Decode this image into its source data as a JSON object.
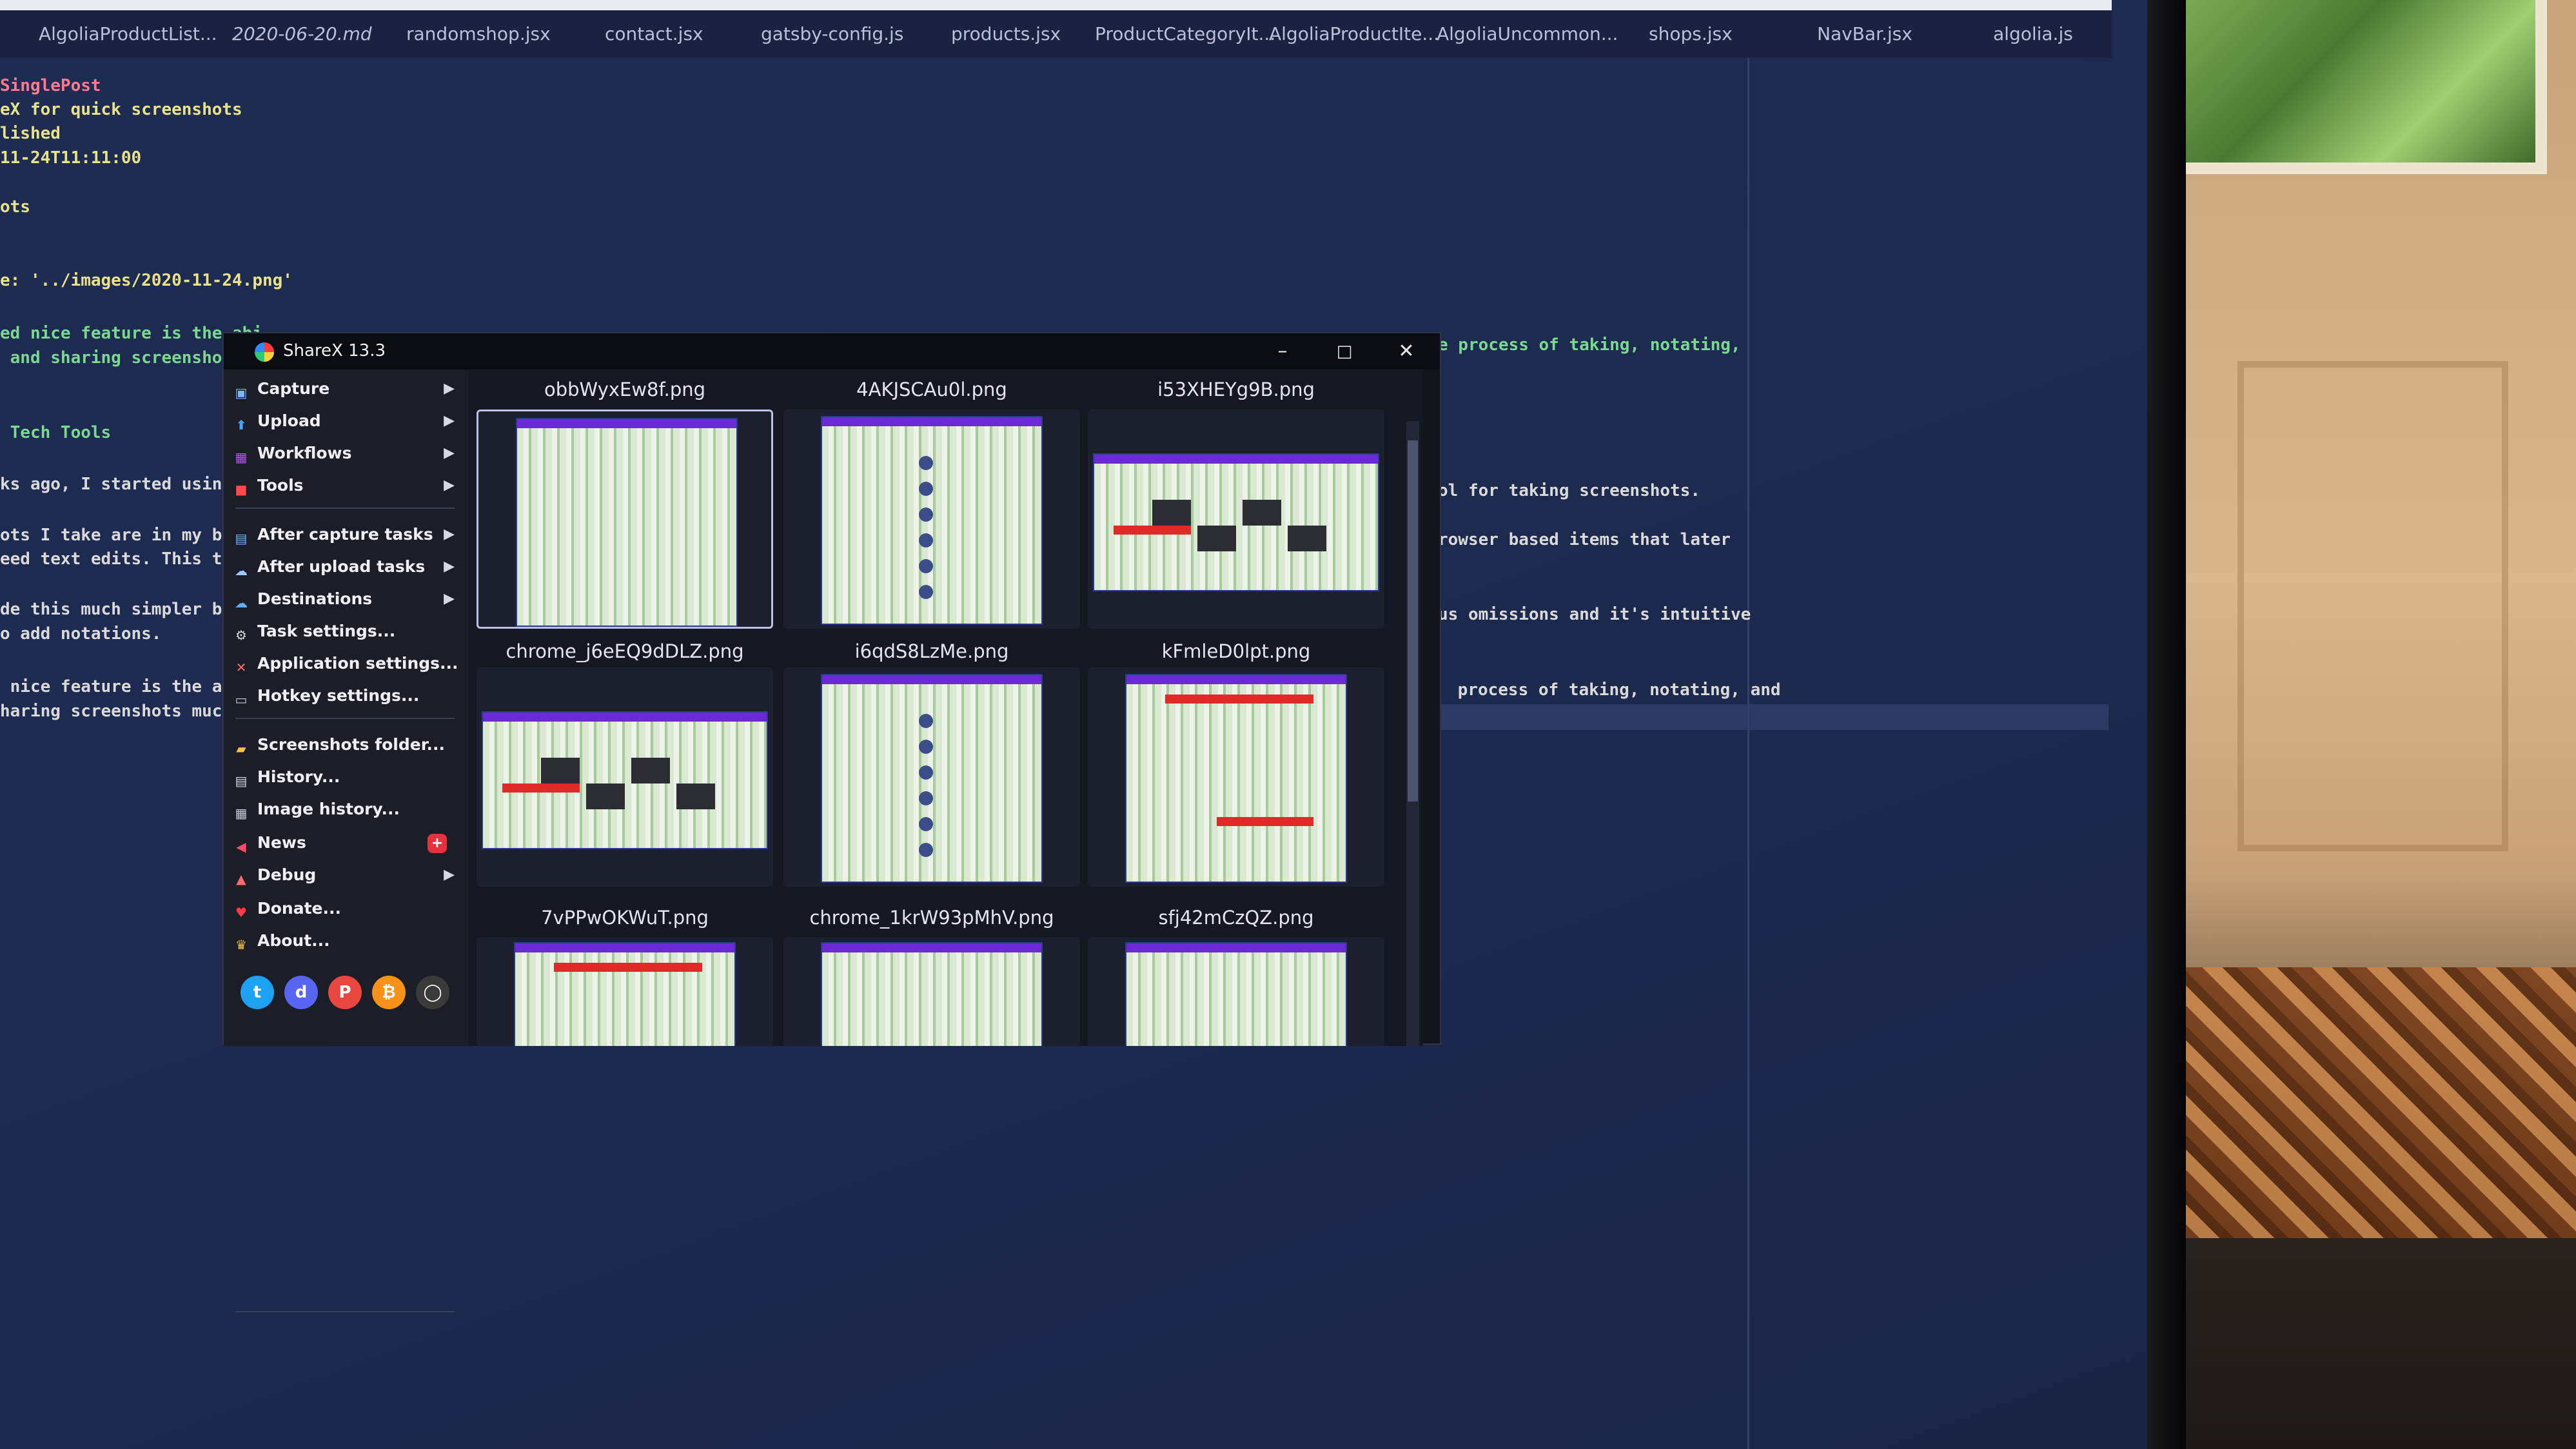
{
  "editor": {
    "tabs": [
      "AlgoliaProductList...",
      "2020-06-20.md",
      "randomshop.jsx",
      "contact.jsx",
      "gatsby-config.js",
      "products.jsx",
      "ProductCategoryIt...",
      "AlgoliaProductIte...",
      "AlgoliaUncommon...",
      "shops.jsx",
      "NavBar.jsx",
      "algolia.js"
    ],
    "code_lines": [
      {
        "text": "SinglePost",
        "color": "red"
      },
      {
        "text": "eX for quick screenshots",
        "color": "str"
      },
      {
        "text": "lished",
        "color": "str"
      },
      {
        "text": "11-24T11:11:00",
        "color": "str"
      },
      {
        "text": "ots",
        "color": "str"
      },
      {
        "text": "e: '../images/2020-11-24.png'",
        "color": "str"
      },
      {
        "text": "ed nice feature is the abi",
        "color": "key"
      },
      {
        "text": " and sharing screenshots m",
        "color": "key"
      },
      {
        "text": " Tech Tools",
        "color": "key"
      },
      {
        "text": "ks ago, I started using S",
        "color": "white"
      },
      {
        "text": "ots I take are in my brow",
        "color": "white"
      },
      {
        "text": "eed text edits. This typi",
        "color": "white"
      },
      {
        "text": "de this much simpler by m",
        "color": "white"
      },
      {
        "text": "o add notations.",
        "color": "white"
      },
      {
        "text": " nice feature is the abil",
        "color": "white"
      },
      {
        "text": "haring screenshots much f",
        "color": "white"
      }
    ],
    "right_lines": [
      {
        "text": "e process of taking, notating,",
        "color": "key"
      },
      {
        "text": "ol for taking screenshots.",
        "color": "white"
      },
      {
        "text": "rowser based items that later",
        "color": "white"
      },
      {
        "text": "us omissions and it's intuitive",
        "color": "white"
      },
      {
        "text": " process of taking, notating, and",
        "color": "white"
      }
    ]
  },
  "sharex": {
    "title": "ShareX 13.3",
    "window_controls": {
      "minimize": "–",
      "maximize": "□",
      "close": "✕"
    },
    "menu": [
      {
        "label": "Capture",
        "icon": "capture-icon",
        "submenu": true
      },
      {
        "label": "Upload",
        "icon": "upload-icon",
        "submenu": true
      },
      {
        "label": "Workflows",
        "icon": "workflows-icon",
        "submenu": true
      },
      {
        "label": "Tools",
        "icon": "tools-icon",
        "submenu": true
      },
      {
        "label": "After capture tasks",
        "icon": "after-capture-icon",
        "submenu": true
      },
      {
        "label": "After upload tasks",
        "icon": "after-upload-icon",
        "submenu": true
      },
      {
        "label": "Destinations",
        "icon": "destinations-icon",
        "submenu": true
      },
      {
        "label": "Task settings...",
        "icon": "gear-icon",
        "submenu": false
      },
      {
        "label": "Application settings...",
        "icon": "wrench-icon",
        "submenu": false
      },
      {
        "label": "Hotkey settings...",
        "icon": "keyboard-icon",
        "submenu": false
      },
      {
        "label": "Screenshots folder...",
        "icon": "folder-icon",
        "submenu": false
      },
      {
        "label": "History...",
        "icon": "history-icon",
        "submenu": false
      },
      {
        "label": "Image history...",
        "icon": "image-history-icon",
        "submenu": false
      },
      {
        "label": "News",
        "icon": "megaphone-icon",
        "submenu": false,
        "badge": "+"
      },
      {
        "label": "Debug",
        "icon": "debug-icon",
        "submenu": true
      },
      {
        "label": "Donate...",
        "icon": "heart-icon",
        "submenu": false
      },
      {
        "label": "About...",
        "icon": "crown-icon",
        "submenu": false
      }
    ],
    "social": [
      "twitter-icon",
      "discord-icon",
      "patreon-icon",
      "bitcoin-icon",
      "github-icon"
    ],
    "thumbnails": [
      {
        "name": "obbWyxEw8f.png",
        "selected": true
      },
      {
        "name": "4AKJSCAu0l.png",
        "selected": false
      },
      {
        "name": "i53XHEYg9B.png",
        "selected": false
      },
      {
        "name": "chrome_j6eEQ9dDLZ.png",
        "selected": false
      },
      {
        "name": "i6qdS8LzMe.png",
        "selected": false
      },
      {
        "name": "kFmleD0lpt.png",
        "selected": false
      },
      {
        "name": "7vPPwOKWuT.png",
        "selected": false
      },
      {
        "name": "chrome_1krW93pMhV.png",
        "selected": false
      },
      {
        "name": "sfj42mCzQZ.png",
        "selected": false
      }
    ],
    "colors": {
      "accent_purple": "#6a2bd6",
      "annotation_red": "#e02a2a",
      "menu_bg": "#1b1d27"
    }
  }
}
